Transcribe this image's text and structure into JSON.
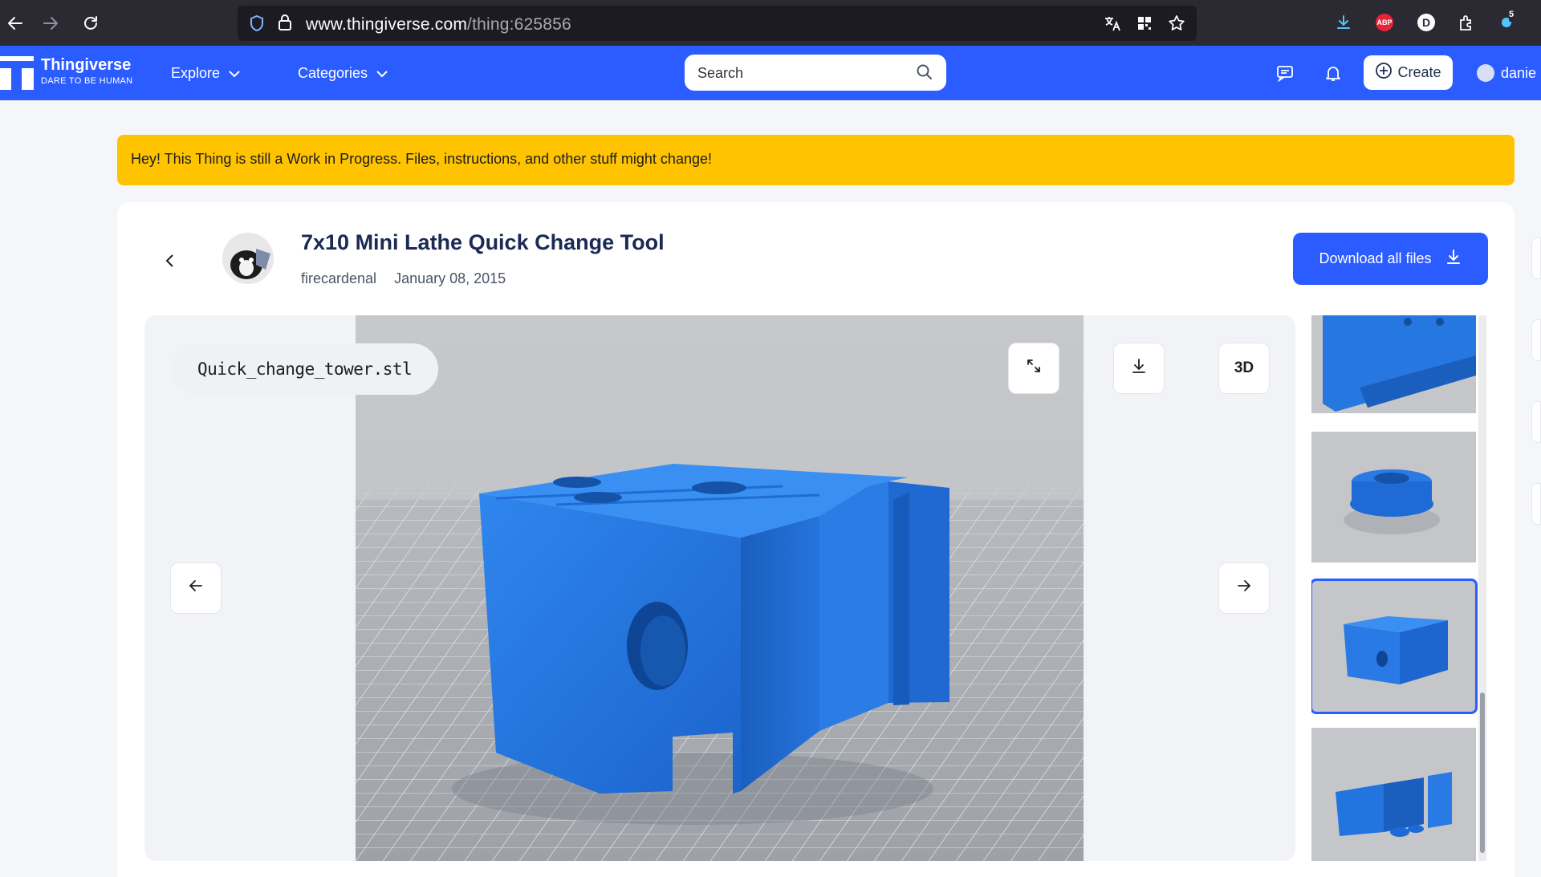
{
  "browser": {
    "url_host": "www.thingiverse.com",
    "url_path": "/thing:625856",
    "extension_badge_count": "5",
    "abp_label": "ABP",
    "d_label": "D"
  },
  "header": {
    "brand_name": "Thingiverse",
    "brand_tagline": "DARE TO BE HUMAN",
    "nav_explore": "Explore",
    "nav_categories": "Categories",
    "search_placeholder": "Search",
    "create_label": "Create",
    "user_name": "danie"
  },
  "banner": {
    "text": "Hey! This Thing is still a Work in Progress. Files, instructions, and other stuff might change!"
  },
  "thing": {
    "title": "7x10 Mini Lathe Quick Change Tool",
    "author": "firecardenal",
    "date": "January 08, 2015",
    "download_all_label": "Download all files"
  },
  "viewer": {
    "filename": "Quick_change_tower.stl",
    "view3d_label": "3D"
  },
  "colors": {
    "brand_blue": "#2b5cff",
    "banner_yellow": "#ffc300",
    "model_blue": "#1f6fd6"
  }
}
